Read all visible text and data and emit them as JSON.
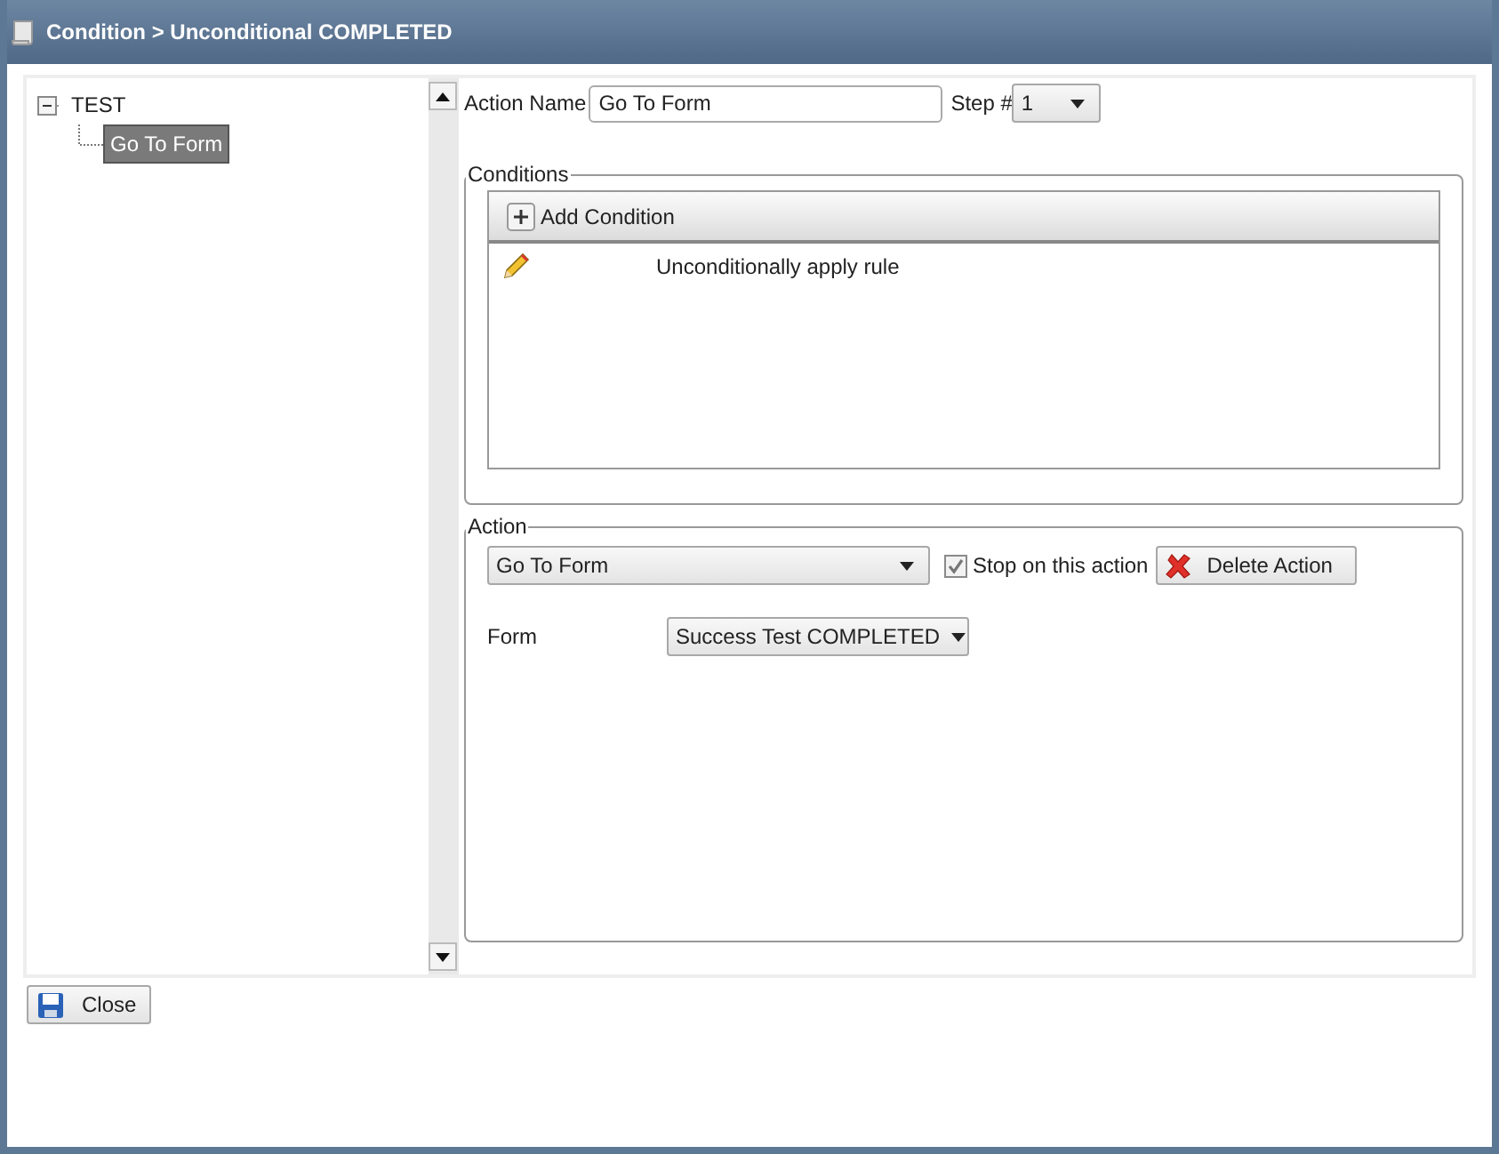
{
  "window": {
    "title": "Condition > Unconditional COMPLETED"
  },
  "tree": {
    "items": [
      {
        "label": "TEST",
        "expanded": true,
        "selected": false,
        "children": [
          {
            "label": "Go To Form",
            "selected": true
          }
        ]
      }
    ]
  },
  "action_name": {
    "label": "Action Name",
    "value": "Go To Form"
  },
  "step": {
    "label": "Step #",
    "value": "1"
  },
  "conditions": {
    "legend": "Conditions",
    "add_button": "Add Condition",
    "rows": [
      {
        "text": "Unconditionally apply rule"
      }
    ]
  },
  "action": {
    "legend": "Action",
    "type": "Go To Form",
    "stop_checkbox": {
      "label": "Stop on this action",
      "checked": true
    },
    "delete_button": "Delete Action",
    "form": {
      "label": "Form",
      "value": "Success Test COMPLETED"
    }
  },
  "close_button": "Close"
}
